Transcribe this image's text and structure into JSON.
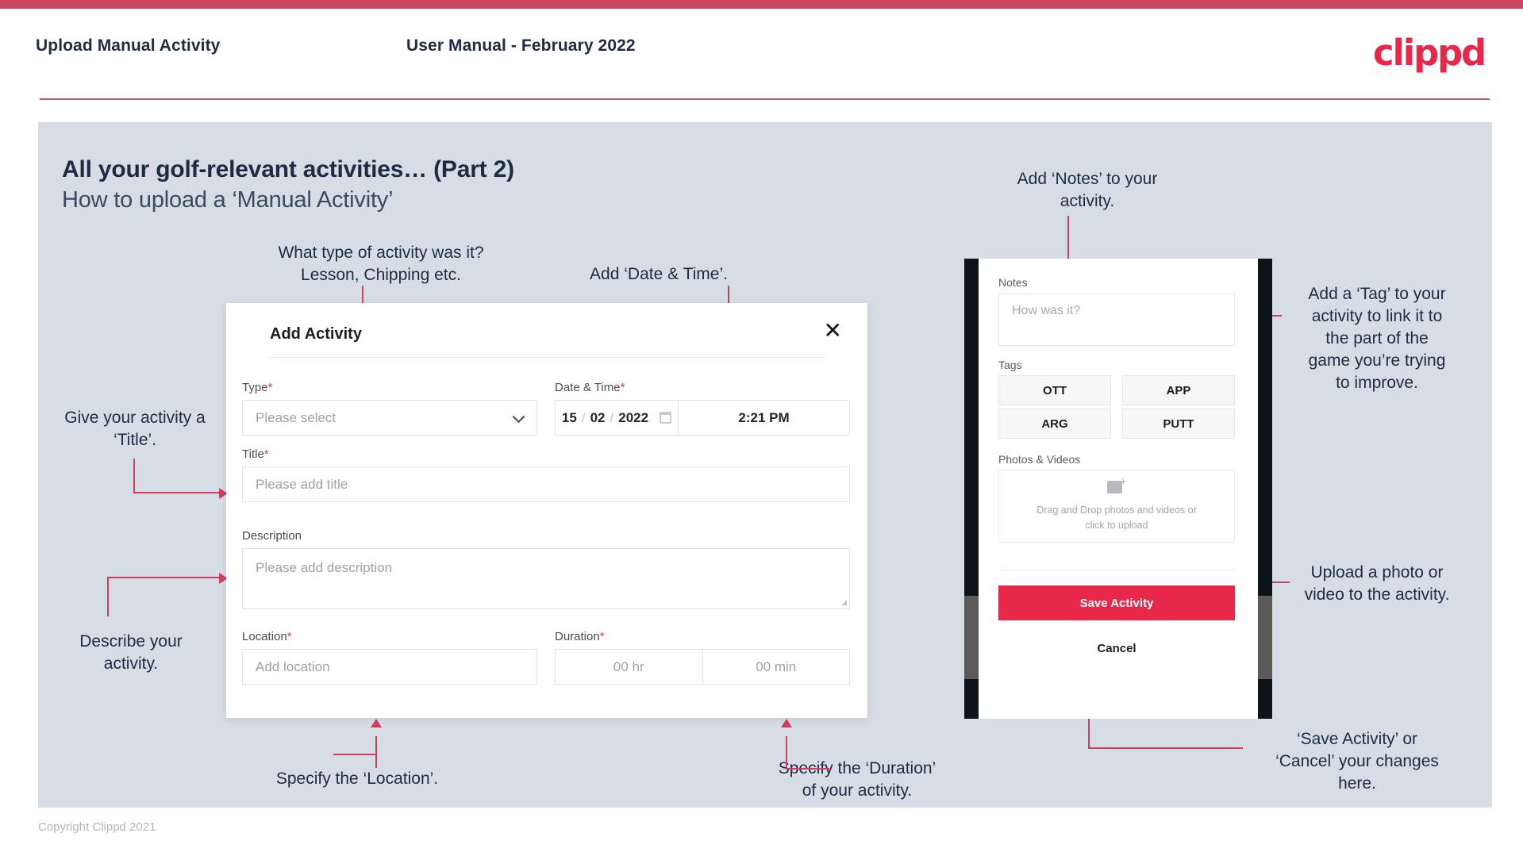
{
  "header": {
    "left_title": "Upload Manual Activity",
    "center_title": "User Manual - February 2022",
    "logo": "clippd"
  },
  "slide": {
    "title": "All your golf-relevant activities… (Part 2)",
    "subtitle": "How to upload a ‘Manual Activity’"
  },
  "annotations": {
    "type": "What type of activity was it?\nLesson, Chipping etc.",
    "datetime": "Add ‘Date & Time’.",
    "title": "Give your activity a\n‘Title’.",
    "description": "Describe your\nactivity.",
    "location": "Specify the ‘Location’.",
    "duration": "Specify the ‘Duration’\nof your activity.",
    "notes": "Add ‘Notes’ to your\nactivity.",
    "tags": "Add a ‘Tag’ to your\nactivity to link it to\nthe part of the\ngame you’re trying\nto improve.",
    "photos": "Upload a photo or\nvideo to the activity.",
    "save_cancel": "‘Save Activity’ or\n‘Cancel’ your changes\nhere."
  },
  "dialog": {
    "title": "Add Activity",
    "close_icon": "✕",
    "fields": {
      "type": {
        "label": "Type",
        "required": "*",
        "placeholder": "Please select"
      },
      "datetime": {
        "label": "Date & Time",
        "required": "*",
        "day": "15",
        "month": "02",
        "year": "2022",
        "sep": "/",
        "time": "2:21 PM"
      },
      "title": {
        "label": "Title",
        "required": "*",
        "placeholder": "Please add title"
      },
      "description": {
        "label": "Description",
        "required": "",
        "placeholder": "Please add description"
      },
      "location": {
        "label": "Location",
        "required": "*",
        "placeholder": "Add location"
      },
      "duration": {
        "label": "Duration",
        "required": "*",
        "hours_placeholder": "00 hr",
        "minutes_placeholder": "00 min"
      }
    }
  },
  "phone": {
    "notes": {
      "label": "Notes",
      "placeholder": "How was it?"
    },
    "tags": {
      "label": "Tags",
      "items": [
        "OTT",
        "APP",
        "ARG",
        "PUTT"
      ]
    },
    "photos": {
      "label": "Photos & Videos",
      "drop_line1": "Drag and Drop photos and videos or",
      "drop_line2": "click to upload"
    },
    "save_label": "Save Activity",
    "cancel_label": "Cancel"
  },
  "footer": {
    "copyright": "Copyright Clippd 2021"
  },
  "colors": {
    "accent": "#e8284b",
    "band": "#cd4560",
    "connector": "#cf3f5d",
    "panel": "#d7dde5",
    "text_dark": "#1d2b45"
  }
}
